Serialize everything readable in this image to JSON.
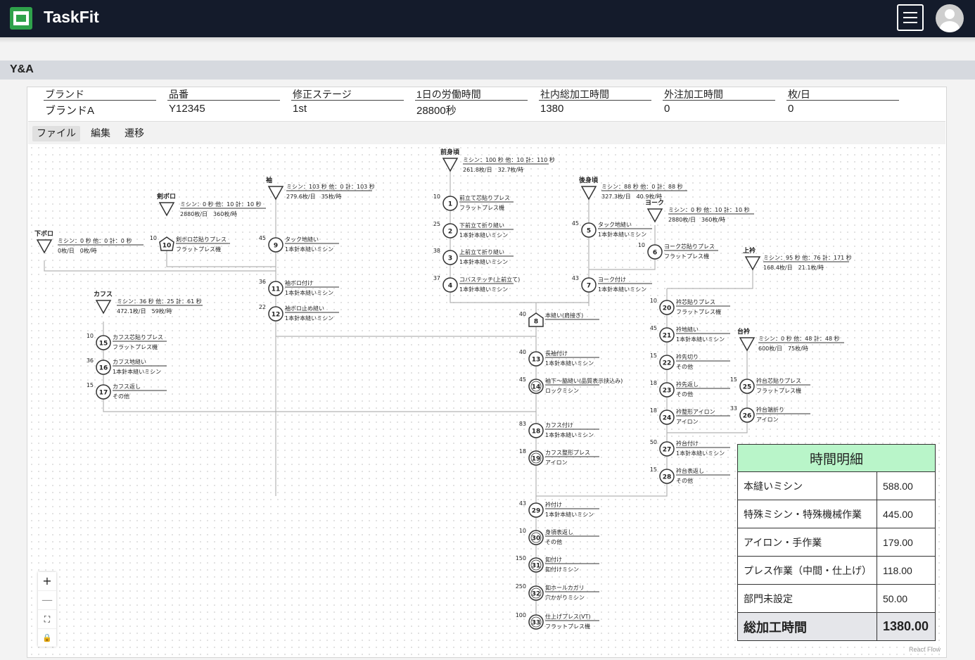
{
  "app": {
    "name": "TaskFit"
  },
  "section_title": "Y&A",
  "info": [
    {
      "label": "ブランド",
      "value": "ブランドA"
    },
    {
      "label": "品番",
      "value": "Y12345"
    },
    {
      "label": "修正ステージ",
      "value": "1st"
    },
    {
      "label": "1日の労働時間",
      "value": "28800秒"
    },
    {
      "label": "社内総加工時間",
      "value": "1380"
    },
    {
      "label": "外注加工時間",
      "value": "0"
    },
    {
      "label": "枚/日",
      "value": "0"
    }
  ],
  "tabs": [
    "ファイル",
    "編集",
    "遷移"
  ],
  "summary": {
    "title": "時間明細",
    "rows": [
      {
        "label": "本縫いミシン",
        "value": "588.00"
      },
      {
        "label": "特殊ミシン・特殊機械作業",
        "value": "445.00"
      },
      {
        "label": "アイロン・手作業",
        "value": "179.00"
      },
      {
        "label": "プレス作業（中間・仕上げ）",
        "value": "118.00"
      },
      {
        "label": "部門未設定",
        "value": "50.00"
      }
    ],
    "total_label": "総加工時間",
    "total_value": "1380.00"
  },
  "watermark": "React Flow",
  "controls": [
    "+",
    "—",
    "⛶",
    "🔒"
  ],
  "parts": [
    {
      "name": "下ボロ",
      "line1": "ミシン：0 秒 他：0 計：0 秒",
      "line2": "0枚/日　0枚/時"
    },
    {
      "name": "剣ボロ",
      "line1": "ミシン：0 秒 他：10 計：10 秒",
      "line2": "2880枚/日　360枚/時"
    },
    {
      "name": "袖",
      "line1": "ミシン：103 秒 他：0 計：103 秒",
      "line2": "279.6枚/日　35枚/時"
    },
    {
      "name": "前身頃",
      "line1": "ミシン：100 秒 他：10 計：110 秒",
      "line2": "261.8枚/日　32.7枚/時"
    },
    {
      "name": "後身頃",
      "line1": "ミシン：88 秒 他：0 計：88 秒",
      "line2": "327.3枚/日　40.9枚/時"
    },
    {
      "name": "ヨーク",
      "line1": "ミシン：0 秒 他：10 計：10 秒",
      "line2": "2880枚/日　360枚/時"
    },
    {
      "name": "上衿",
      "line1": "ミシン：95 秒 他：76 計：171 秒",
      "line2": "168.4枚/日　21.1枚/時"
    },
    {
      "name": "カフス",
      "line1": "ミシン：36 秒 他：25 計：61 秒",
      "line2": "472.1枚/日　59枚/時"
    },
    {
      "name": "台衿",
      "line1": "ミシン：0 秒 他：48 計：48 秒",
      "line2": "600枚/日　75枚/時"
    }
  ],
  "ops": [
    {
      "no": "1",
      "time": "10",
      "name": "前立て芯貼りプレス",
      "machine": "フラットプレス機"
    },
    {
      "no": "2",
      "time": "25",
      "name": "下前立て折り縫い",
      "machine": "1本針本縫いミシン"
    },
    {
      "no": "3",
      "time": "38",
      "name": "上前立て折り縫い",
      "machine": "1本針本縫いミシン"
    },
    {
      "no": "4",
      "time": "37",
      "name": "コバステッチ(上前立て)",
      "machine": "1本針本縫いミシン"
    },
    {
      "no": "5",
      "time": "45",
      "name": "タック地縫い",
      "machine": "1本針本縫いミシン"
    },
    {
      "no": "6",
      "time": "10",
      "name": "ヨーク芯貼りプレス",
      "machine": "フラットプレス機"
    },
    {
      "no": "7",
      "time": "43",
      "name": "ヨーク付け",
      "machine": "1本針本縫いミシン"
    },
    {
      "no": "8",
      "time": "40",
      "name": "本縫い(肩接ぎ)",
      "machine": ""
    },
    {
      "no": "9",
      "time": "45",
      "name": "タック地縫い",
      "machine": "1本針本縫いミシン"
    },
    {
      "no": "10",
      "time": "10",
      "name": "剣ボロ芯貼りプレス",
      "machine": "フラットプレス機"
    },
    {
      "no": "11",
      "time": "36",
      "name": "袖ボロ付け",
      "machine": "1本針本縫いミシン"
    },
    {
      "no": "12",
      "time": "22",
      "name": "袖ボロ止め縫い",
      "machine": "1本針本縫いミシン"
    },
    {
      "no": "13",
      "time": "40",
      "name": "長袖付け",
      "machine": "1本針本縫いミシン"
    },
    {
      "no": "14",
      "time": "45",
      "name": "袖下〜脇縫い(品質表示挟込み)",
      "machine": "ロックミシン"
    },
    {
      "no": "15",
      "time": "10",
      "name": "カフス芯貼りプレス",
      "machine": "フラットプレス機"
    },
    {
      "no": "16",
      "time": "36",
      "name": "カフス地縫い",
      "machine": "1本針本縫いミシン"
    },
    {
      "no": "17",
      "time": "15",
      "name": "カフス返し",
      "machine": "その他"
    },
    {
      "no": "18",
      "time": "83",
      "name": "カフス付け",
      "machine": "1本針本縫いミシン"
    },
    {
      "no": "19",
      "time": "18",
      "name": "カフス整形プレス",
      "machine": "アイロン"
    },
    {
      "no": "20",
      "time": "10",
      "name": "衿芯貼りプレス",
      "machine": "フラットプレス機"
    },
    {
      "no": "21",
      "time": "45",
      "name": "衿地縫い",
      "machine": "1本針本縫いミシン"
    },
    {
      "no": "22",
      "time": "15",
      "name": "衿先切り",
      "machine": "その他"
    },
    {
      "no": "23",
      "time": "18",
      "name": "衿先返し",
      "machine": "その他"
    },
    {
      "no": "24",
      "time": "18",
      "name": "衿整形アイロン",
      "machine": "アイロン"
    },
    {
      "no": "25",
      "time": "15",
      "name": "衿台芯貼りプレス",
      "machine": "フラットプレス機"
    },
    {
      "no": "26",
      "time": "33",
      "name": "衿台端折り",
      "machine": "アイロン"
    },
    {
      "no": "27",
      "time": "50",
      "name": "衿台付け",
      "machine": "1本針本縫いミシン"
    },
    {
      "no": "28",
      "time": "15",
      "name": "衿台表返し",
      "machine": "その他"
    },
    {
      "no": "29",
      "time": "43",
      "name": "衿付け",
      "machine": "1本針本縫いミシン"
    },
    {
      "no": "30",
      "time": "10",
      "name": "身頃表返し",
      "machine": "その他"
    },
    {
      "no": "31",
      "time": "150",
      "name": "釦付け",
      "machine": "釦付けミシン"
    },
    {
      "no": "32",
      "time": "250",
      "name": "釦ホールカガリ",
      "machine": "穴かがりミシン"
    },
    {
      "no": "33",
      "time": "100",
      "name": "仕上げプレス(VT)",
      "machine": "フラットプレス機"
    }
  ]
}
